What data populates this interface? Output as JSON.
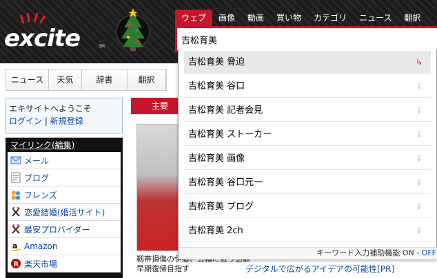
{
  "header": {
    "logo_text": "excite",
    "logo_mark": "SM",
    "tabs": [
      "ウェブ",
      "画像",
      "動画",
      "買い物",
      "カテゴリ",
      "ニュース",
      "翻訳"
    ],
    "search_value": "吉松育美"
  },
  "nav": {
    "items": [
      "ニュース",
      "天気",
      "辞書",
      "翻訳"
    ]
  },
  "welcome": {
    "title": "エキサイトへようこそ",
    "login": "ログイン",
    "separator": "|",
    "register": "新規登録"
  },
  "mylinks": {
    "title": "マイリンク(編集)",
    "items": [
      {
        "label": "メール",
        "icon": "mail-icon"
      },
      {
        "label": "ブログ",
        "icon": "blog-icon"
      },
      {
        "label": "フレンズ",
        "icon": "friends-icon"
      },
      {
        "label": "恋愛結婚(婚活サイト)",
        "icon": "excite-icon"
      },
      {
        "label": "最安プロバイダー",
        "icon": "excite-icon"
      },
      {
        "label": "Amazon",
        "icon": "amazon-icon"
      },
      {
        "label": "楽天市場",
        "icon": "rakuten-icon"
      }
    ]
  },
  "main": {
    "section_label": "主要",
    "caption_line1": "靱帯損傷の伊藤、五輪に救う感歓",
    "caption_line2": "早期復帰目指す",
    "ad_text": "デジタルで広がるアイデアの可能性[PR]"
  },
  "suggestions": {
    "items": [
      "吉松育美 脅迫",
      "吉松育美 谷口",
      "吉松育美 記者会見",
      "吉松育美 ストーカー",
      "吉松育美 画像",
      "吉松育美 谷口元一",
      "吉松育美 ブログ",
      "吉松育美 2ch"
    ],
    "footer_label": "キーワード入力補助機能",
    "footer_on": "ON",
    "footer_sep": "-",
    "footer_off": "OFF"
  },
  "colors": {
    "brand_red": "#c5162c",
    "link_blue": "#0645ad"
  }
}
